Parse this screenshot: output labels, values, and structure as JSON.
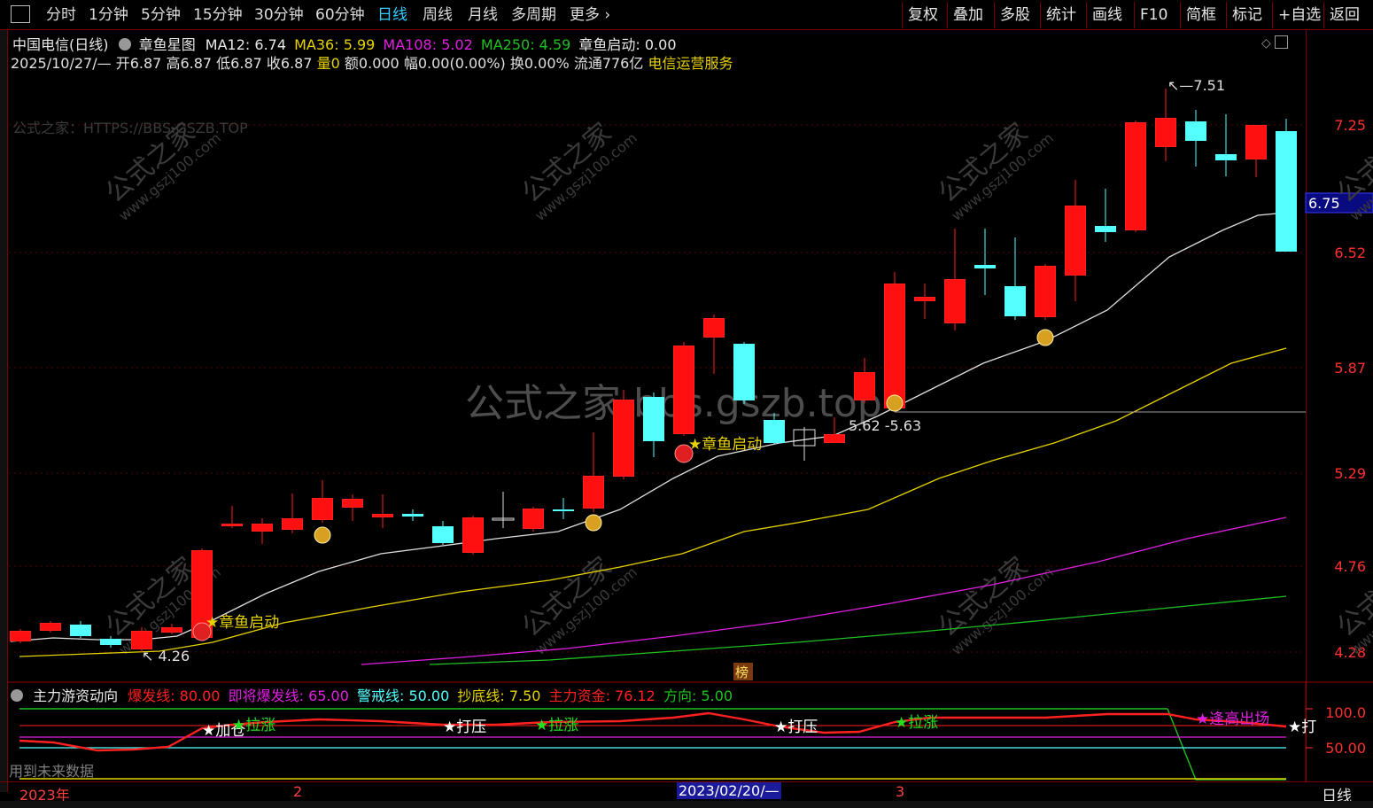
{
  "toolbar": {
    "tabs": [
      "分时",
      "1分钟",
      "5分钟",
      "15分钟",
      "30分钟",
      "60分钟",
      "日线",
      "周线",
      "月线",
      "多周期",
      "更多"
    ],
    "active_tab": "日线",
    "right_buttons": [
      "复权",
      "叠加",
      "多股",
      "统计",
      "画线",
      "F10",
      "简框",
      "标记",
      "+自选",
      "返回"
    ]
  },
  "header": {
    "stock": "中国电信(日线)",
    "indicator": "章鱼星图",
    "ma12": "MA12: 6.74",
    "ma36": "MA36: 5.99",
    "ma108": "MA108: 5.02",
    "ma250": "MA250: 4.59",
    "signal": "章鱼启动: 0.00",
    "date": "2025/10/27/—",
    "open": "开6.87",
    "high": "高6.87",
    "low": "低6.87",
    "close": "收6.87",
    "vol": "量0",
    "amount": "额0.000",
    "range": "幅0.00(0.00%)",
    "turnover": "换0.00%",
    "float": "流通776亿",
    "industry": "电信运营服务"
  },
  "watermarks": {
    "top_left": "公式之家：HTTPS://BBS.GSZB.TOP",
    "center": "公式之家 bbs.gszb.top",
    "diag_cn": "公式之家",
    "diag_url": "www.gszj100.com"
  },
  "price_axis": {
    "ticks": [
      "7.25",
      "6.52",
      "5.87",
      "5.29",
      "4.76",
      "4.28"
    ],
    "current": "6.75"
  },
  "annotations": {
    "high": "7.51",
    "low": "4.26",
    "mid": "5.62 -5.63",
    "signal1": "★章鱼启动",
    "signal2": "★章鱼启动",
    "rank": "榜"
  },
  "indicator_panel": {
    "name": "主力游资动向",
    "baofa": "爆发线: 80.00",
    "jijiang": "即将爆发线: 65.00",
    "jingjie": "警戒线: 50.00",
    "chaodi": "抄底线: 7.50",
    "zijin": "主力资金: 76.12",
    "fangxiang": "方向: 5.00",
    "axis": [
      "100.0",
      "50.00"
    ],
    "labels": [
      "★加仓",
      "★拉涨",
      "★打压",
      "★拉涨",
      "★打压",
      "★拉涨",
      "★逢高出场",
      "★打"
    ],
    "note": "用到未来数据"
  },
  "datebar": {
    "year": "2023年",
    "m2": "2",
    "cursor": "2023/02/20/—",
    "m3": "3",
    "period": "日线"
  },
  "colors": {
    "up": "#ff2020",
    "down": "#54ffff",
    "ma12": "#e0e0e0",
    "ma36": "#e6d200",
    "ma108": "#e020e0",
    "ma250": "#20c020"
  }
}
